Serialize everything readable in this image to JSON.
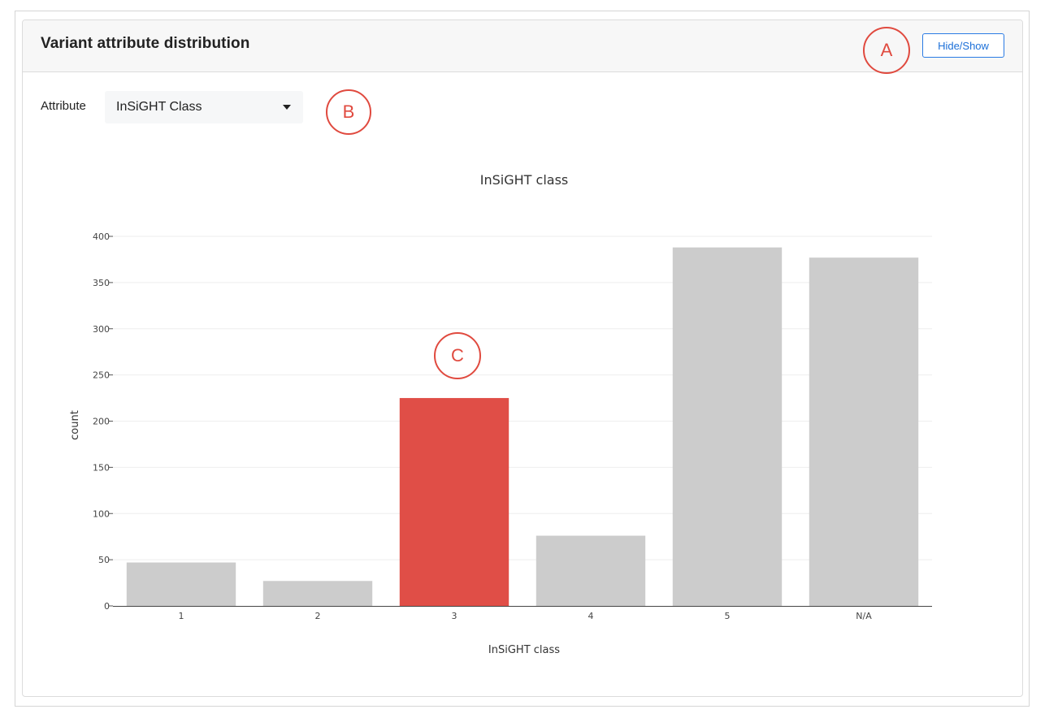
{
  "panel": {
    "title": "Variant attribute distribution",
    "toggle_label": "Hide/Show"
  },
  "controls": {
    "attribute_label": "Attribute",
    "attribute_value": "InSiGHT Class"
  },
  "annotations": {
    "a": "A",
    "b": "B",
    "c": "C"
  },
  "colors": {
    "bar_default": "#cccccc",
    "bar_highlight": "#e04e47",
    "annotation": "#e04a3f",
    "button_accent": "#2a7be4"
  },
  "chart_data": {
    "type": "bar",
    "title": "InSiGHT class",
    "xlabel": "InSiGHT class",
    "ylabel": "count",
    "categories": [
      "1",
      "2",
      "3",
      "4",
      "5",
      "N/A"
    ],
    "values": [
      47,
      27,
      225,
      76,
      388,
      377
    ],
    "highlighted_category": "3",
    "ylim": [
      0,
      400
    ],
    "yticks": [
      0,
      50,
      100,
      150,
      200,
      250,
      300,
      350,
      400
    ],
    "grid": true,
    "legend": "none"
  }
}
